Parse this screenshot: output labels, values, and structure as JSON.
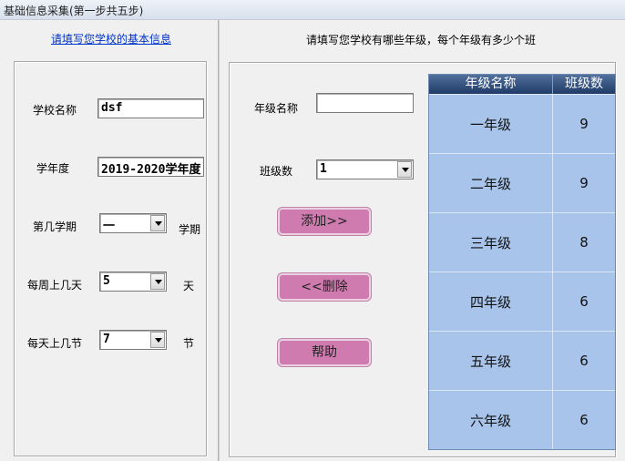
{
  "window": {
    "title": "基础信息采集(第一步共五步)"
  },
  "left": {
    "link_title": "请填写您学校的基本信息",
    "school_name_label": "学校名称",
    "school_name_value": "dsf",
    "school_year_label": "学年度",
    "school_year_value": "2019-2020学年度",
    "semester_label": "第几学期",
    "semester_value": "一",
    "semester_unit": "学期",
    "days_label": "每周上几天",
    "days_value": "5",
    "days_unit": "天",
    "periods_label": "每天上几节",
    "periods_value": "7",
    "periods_unit": "节"
  },
  "right": {
    "title": "请填写您学校有哪些年级，每个年级有多少个班",
    "grade_name_label": "年级名称",
    "grade_name_value": "",
    "class_count_label": "班级数",
    "class_count_value": "1",
    "add_button": "添加>>",
    "delete_button": "<<删除",
    "help_button": "帮助"
  },
  "grade_table": {
    "headers": [
      "年级名称",
      "班级数"
    ],
    "rows": [
      [
        "一年级",
        "9"
      ],
      [
        "二年级",
        "9"
      ],
      [
        "三年级",
        "8"
      ],
      [
        "四年级",
        "6"
      ],
      [
        "五年级",
        "6"
      ],
      [
        "六年级",
        "6"
      ]
    ]
  }
}
